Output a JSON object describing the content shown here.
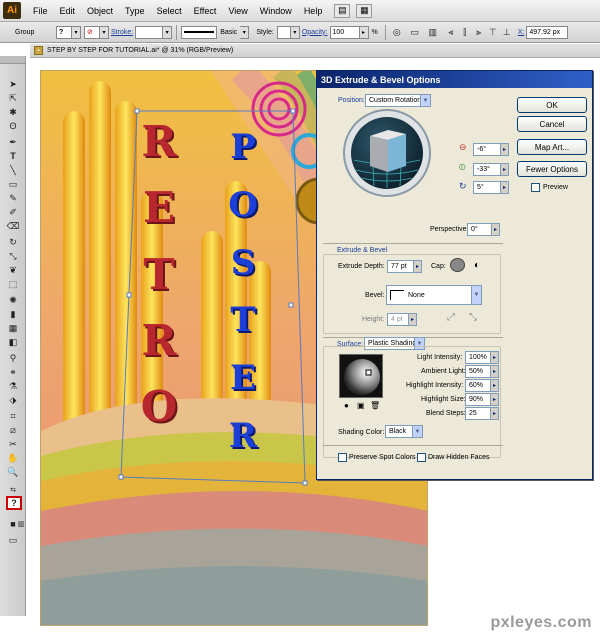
{
  "menubar": {
    "logo": "Ai",
    "items": [
      "File",
      "Edit",
      "Object",
      "Type",
      "Select",
      "Effect",
      "View",
      "Window",
      "Help"
    ]
  },
  "controlbar": {
    "selection": "Group",
    "stroke_label": "Stroke:",
    "brush": "Basic",
    "style_label": "Style:",
    "opacity_label": "Opacity:",
    "opacity_value": "100",
    "percent": "%",
    "x_label": "X:",
    "x_value": "497.92 px"
  },
  "document": {
    "tab_title": "STEP BY STEP FOR TUTORIAL.ai* @ 31% (RGB/Preview)"
  },
  "artwork": {
    "word1": "RETRO",
    "word2": "POSTER"
  },
  "dialog": {
    "title": "3D Extrude & Bevel Options",
    "position_label": "Position:",
    "position_value": "Custom Rotation",
    "rot_x": "-6°",
    "rot_y": "-33°",
    "rot_z": "5°",
    "perspective_label": "Perspective:",
    "perspective_value": "0°",
    "ok": "OK",
    "cancel": "Cancel",
    "map_art": "Map Art...",
    "fewer_options": "Fewer Options",
    "preview": "Preview",
    "extrude_section": "Extrude & Bevel",
    "extrude_depth_label": "Extrude Depth:",
    "extrude_depth_value": "77 pt",
    "cap_label": "Cap:",
    "bevel_label": "Bevel:",
    "bevel_value": "None",
    "height_label": "Height:",
    "height_value": "4 pt",
    "surface_label": "Surface:",
    "surface_value": "Plastic Shading",
    "light_intensity_label": "Light Intensity:",
    "light_intensity_value": "100%",
    "ambient_light_label": "Ambient Light:",
    "ambient_light_value": "50%",
    "highlight_intensity_label": "Highlight Intensity:",
    "highlight_intensity_value": "60%",
    "highlight_size_label": "Highlight Size:",
    "highlight_size_value": "90%",
    "blend_steps_label": "Blend Steps:",
    "blend_steps_value": "25",
    "shading_color_label": "Shading Color:",
    "shading_color_value": "Black",
    "preserve_spot": "Preserve Spot Colors",
    "draw_hidden": "Draw Hidden Faces"
  },
  "watermark": "pxleyes.com"
}
